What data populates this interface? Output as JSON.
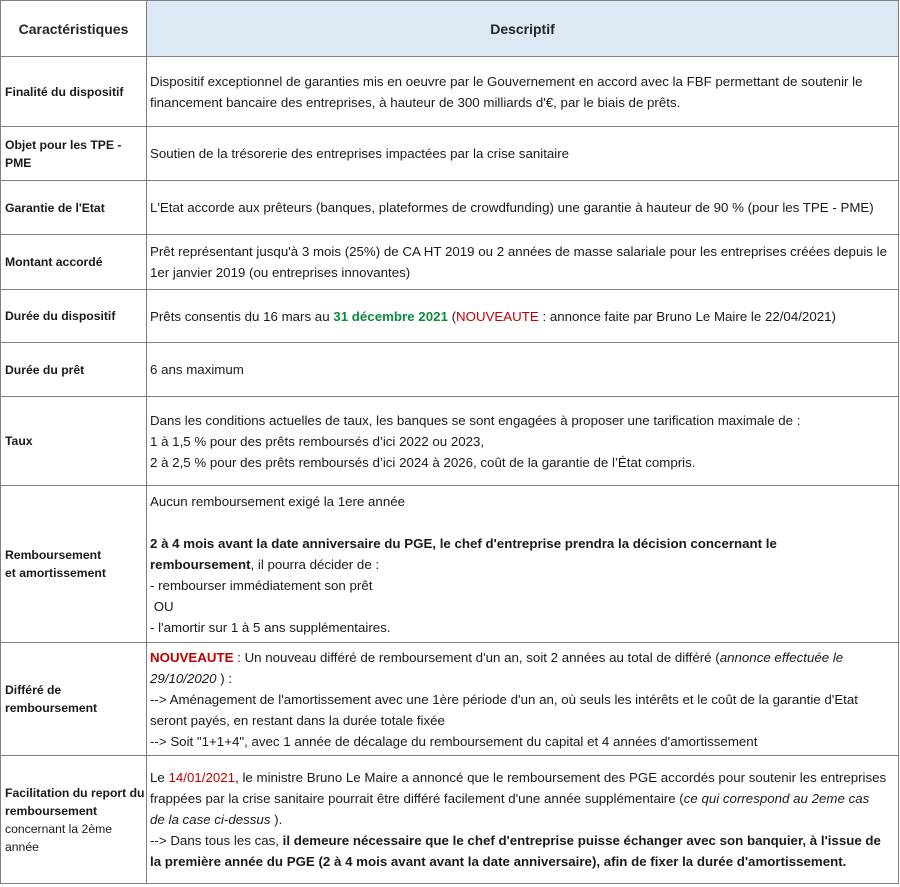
{
  "header": {
    "col1": "Caractéristiques",
    "col2": "Descriptif"
  },
  "rows": [
    {
      "label": "Finalité du dispositif",
      "lines": [
        "Dispositif exceptionnel de garanties mis en oeuvre par le Gouvernement en accord avec la FBF permettant de soutenir le",
        "financement bancaire des entreprises, à hauteur de 300 milliards d'€,  par le biais de prêts."
      ]
    },
    {
      "label_lines": [
        "Objet pour les TPE -",
        "PME"
      ],
      "lines": [
        "Soutien de la trésorerie des entreprises impactées par la crise sanitaire"
      ]
    },
    {
      "label": "Garantie de l'Etat",
      "lines": [
        "L'Etat accorde aux prêteurs (banques, plateformes de crowdfunding) une garantie à hauteur de 90 % (pour les TPE - PME)"
      ]
    },
    {
      "label": "Montant accordé",
      "lines": [
        "Prêt représentant jusqu'à 3 mois (25%) de CA HT 2019 ou 2 années de masse salariale pour les entreprises créées depuis le",
        "1er janvier 2019 (ou entreprises innovantes)"
      ]
    },
    {
      "label": "Durée du dispositif",
      "text_a": "Prêts consentis du 16 mars au ",
      "text_date": "31 décembre 2021",
      "text_b": " (",
      "text_new": "NOUVEAUTE",
      "text_c": " : annonce faite par Bruno Le Maire le 22/04/2021)"
    },
    {
      "label": "Durée du prêt",
      "lines": [
        "6 ans maximum"
      ]
    },
    {
      "label": "Taux",
      "lines": [
        "Dans les conditions actuelles de taux, les banques se sont engagées à proposer une tarification maximale de :",
        "1 à 1,5 % pour des prêts remboursés d’ici 2022 ou 2023,",
        "2 à 2,5 % pour des prêts remboursés d’ici 2024 à 2026, coût de la garantie de l’État compris."
      ]
    },
    {
      "label_lines": [
        "Remboursement",
        "et amortissement"
      ],
      "line1": "Aucun remboursement exigé la 1ere année",
      "bold1": "2 à 4 mois avant la date anniversaire du PGE, le chef d'entreprise prendra la décision concernant le",
      "bold2": "remboursement",
      "after_bold2": ", il pourra décider de :",
      "line4": "- rembourser immédiatement son prêt",
      "line5": " OU",
      "line6": "- l'amortir sur 1 à 5 ans supplémentaires."
    },
    {
      "label_lines": [
        "Différé de",
        "remboursement"
      ],
      "new": "NOUVEAUTE",
      "l1a": " : Un nouveau différé de remboursement d'un an, soit 2 années au total de différé (",
      "l1i": "annonce effectuée le",
      "l2i": "29/10/2020",
      "l2b": " ) :",
      "l3": "--> Aménagement de l'amortissement avec une 1ère période d'un an, où seuls les intérêts et le coût de la garantie d'Etat",
      "l4": "seront payés, en restant dans la durée totale fixée",
      "l5": "--> Soit \"1+1+4\", avec 1 année de décalage du remboursement du capital et 4 années d'amortissement"
    },
    {
      "label_lines_bold": [
        "Facilitation du report du",
        "remboursement"
      ],
      "label_lines_plain": [
        "concernant la 2ème",
        "année"
      ],
      "l1a": "Le ",
      "l1date": "14/01/2021",
      "l1b": ", le ministre Bruno Le Maire a annoncé que le remboursement des PGE accordés pour soutenir les entreprises",
      "l2a": "frappées par la crise sanitaire pourrait être différé facilement d'une année supplémentaire (",
      "l2i": "ce qui correspond au 2eme cas",
      "l3i": "de la case ci-dessus",
      "l3b": " ).",
      "l4a": "--> Dans tous les cas, ",
      "l4b": "il demeure nécessaire que le chef d'entreprise puisse échanger avec son banquier, à l'issue de",
      "l5b": "la première année du PGE (2 à 4 mois avant avant la date anniversaire), afin de fixer la durée d'amortissement."
    }
  ]
}
